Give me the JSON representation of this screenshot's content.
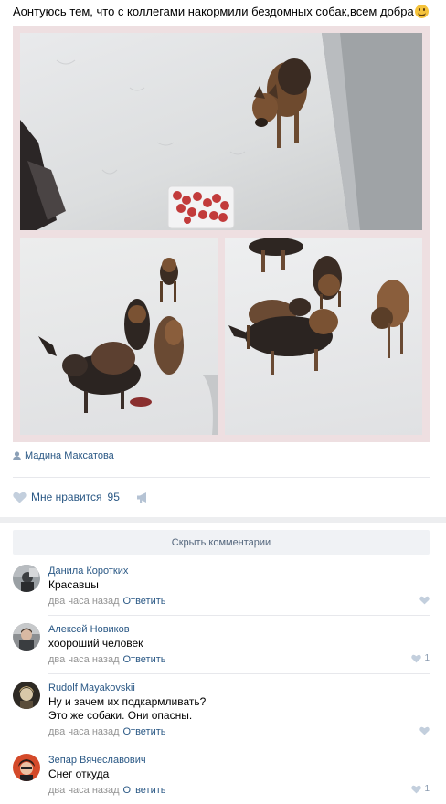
{
  "post": {
    "text": "Аонтуюсь тем, что с коллегами накормили бездомных собак,всем добра",
    "emoji_icon": "smiling-face-emoji",
    "author": "Мадина Максатова"
  },
  "actions": {
    "like_label": "Мне нравится",
    "like_count": "95",
    "like_icon": "heart-icon",
    "share_icon": "megaphone-icon"
  },
  "hide_comments_label": "Скрыть комментарии",
  "comments": [
    {
      "name": "Данила Коротких",
      "text_lines": [
        "Красавцы"
      ],
      "time": "два часа назад",
      "reply": "Ответить",
      "likes": ""
    },
    {
      "name": "Алексей Новиков",
      "text_lines": [
        "хоороший человек"
      ],
      "time": "два часа назад",
      "reply": "Ответить",
      "likes": "1"
    },
    {
      "name": "Rudolf Mayakovskii",
      "text_lines": [
        "Ну и зачем их подкармливать?",
        "Это же собаки. Они опасны."
      ],
      "time": "два часа назад",
      "reply": "Ответить",
      "likes": ""
    },
    {
      "name": "Зепар Вячеславович",
      "text_lines": [
        "Снег откуда"
      ],
      "time": "два часа назад",
      "reply": "Ответить",
      "likes": "1"
    }
  ],
  "colors": {
    "link": "#2a5885",
    "meta": "#939393",
    "frame": "#eedfe1",
    "band": "#edeef0"
  }
}
